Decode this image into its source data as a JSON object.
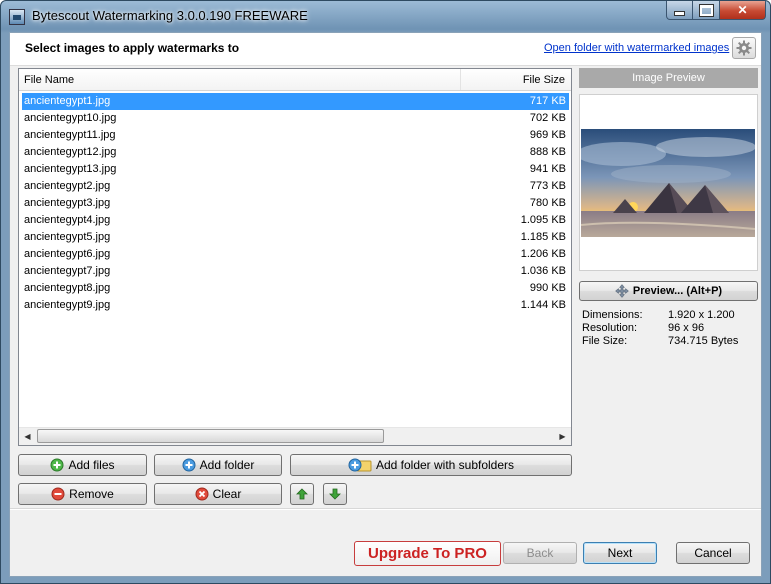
{
  "window": {
    "title": "Bytescout Watermarking 3.0.0.190 FREEWARE"
  },
  "header": {
    "title": "Select images to apply watermarks to",
    "link": "Open folder with watermarked images"
  },
  "list": {
    "columns": {
      "name": "File Name",
      "size": "File Size"
    },
    "rows": [
      {
        "name": "ancientegypt1.jpg",
        "size": "717 KB"
      },
      {
        "name": "ancientegypt10.jpg",
        "size": "702 KB"
      },
      {
        "name": "ancientegypt11.jpg",
        "size": "969 KB"
      },
      {
        "name": "ancientegypt12.jpg",
        "size": "888 KB"
      },
      {
        "name": "ancientegypt13.jpg",
        "size": "941 KB"
      },
      {
        "name": "ancientegypt2.jpg",
        "size": "773 KB"
      },
      {
        "name": "ancientegypt3.jpg",
        "size": "780 KB"
      },
      {
        "name": "ancientegypt4.jpg",
        "size": "1.095 KB"
      },
      {
        "name": "ancientegypt5.jpg",
        "size": "1.185 KB"
      },
      {
        "name": "ancientegypt6.jpg",
        "size": "1.206 KB"
      },
      {
        "name": "ancientegypt7.jpg",
        "size": "1.036 KB"
      },
      {
        "name": "ancientegypt8.jpg",
        "size": "990 KB"
      },
      {
        "name": "ancientegypt9.jpg",
        "size": "1.144 KB"
      }
    ],
    "selected_index": 0
  },
  "buttons": {
    "add_files": "Add files",
    "add_folder": "Add folder",
    "add_folder_sub": "Add folder with subfolders",
    "remove": "Remove",
    "clear": "Clear"
  },
  "preview": {
    "title": "Image Preview",
    "button": "Preview... (Alt+P)",
    "dimensions_label": "Dimensions:",
    "dimensions": "1.920 x 1.200",
    "resolution_label": "Resolution:",
    "resolution": "96 x 96",
    "filesize_label": "File Size:",
    "filesize": "734.715 Bytes"
  },
  "footer": {
    "upgrade": "Upgrade To PRO",
    "back": "Back",
    "next": "Next",
    "cancel": "Cancel"
  },
  "colors": {
    "selection": "#3399ff",
    "upgrade": "#cc2222",
    "link": "#0033cc"
  },
  "icons": [
    "app-icon",
    "gear-icon",
    "add-icon",
    "add-folder-icon",
    "remove-icon",
    "clear-icon",
    "up-arrow-icon",
    "down-arrow-icon",
    "move-icon"
  ]
}
